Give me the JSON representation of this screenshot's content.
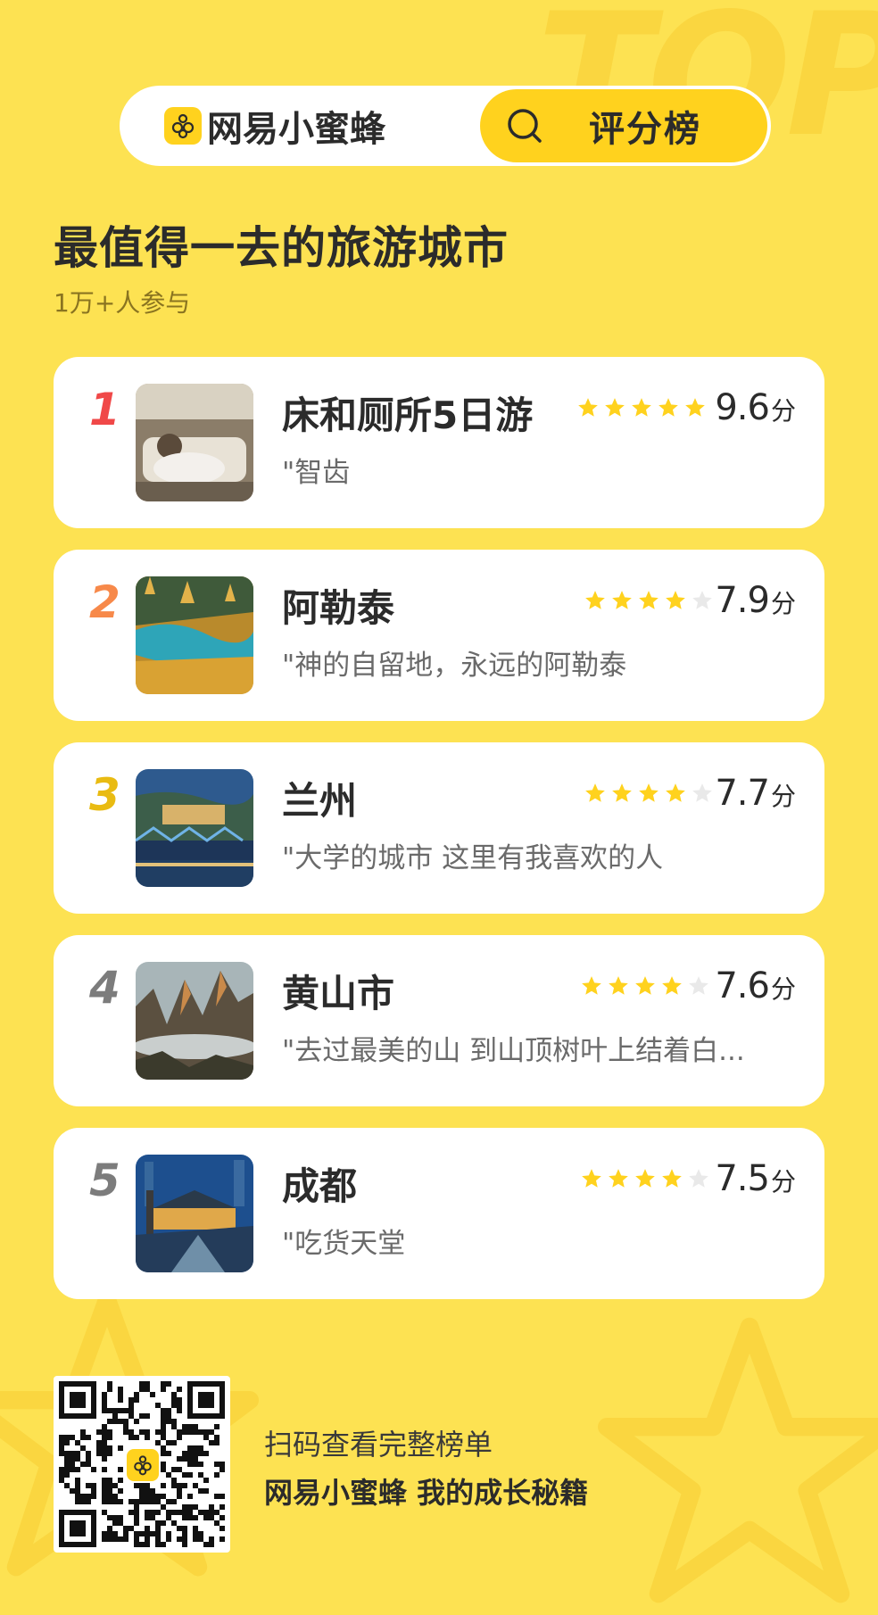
{
  "colors": {
    "background": "#FDE252",
    "accent": "#FFD21E",
    "rank1": "#F04848",
    "rank2": "#F7894A",
    "rank3": "#E9BB12",
    "rank_other": "#7C7C7C",
    "star_on": "#FFD21E",
    "star_off": "#E9E9E9"
  },
  "header": {
    "brand_name": "网易小蜜蜂",
    "brand_icon": "bee-logo-icon",
    "tab_icon": "search-icon",
    "tab_label": "评分榜",
    "background_word": "TOP"
  },
  "ranking": {
    "title": "最值得一去的旅游城市",
    "participants": "1万+人参与",
    "items": [
      {
        "rank": "1",
        "name": "床和厕所5日游",
        "stars": 5,
        "score": "9.6",
        "unit": "分",
        "quote": "\"智齿"
      },
      {
        "rank": "2",
        "name": "阿勒泰",
        "stars": 4,
        "score": "7.9",
        "unit": "分",
        "quote": "\"神的自留地，永远的阿勒泰"
      },
      {
        "rank": "3",
        "name": "兰州",
        "stars": 4,
        "score": "7.7",
        "unit": "分",
        "quote": "\"大学的城市 这里有我喜欢的人"
      },
      {
        "rank": "4",
        "name": "黄山市",
        "stars": 4,
        "score": "7.6",
        "unit": "分",
        "quote": "\"去过最美的山 到山顶树叶上结着白..."
      },
      {
        "rank": "5",
        "name": "成都",
        "stars": 4,
        "score": "7.5",
        "unit": "分",
        "quote": "\"吃货天堂"
      }
    ]
  },
  "footer": {
    "qr_icon": "qr-code-icon",
    "line1": "扫码查看完整榜单",
    "line2": "网易小蜜蜂 我的成长秘籍"
  }
}
